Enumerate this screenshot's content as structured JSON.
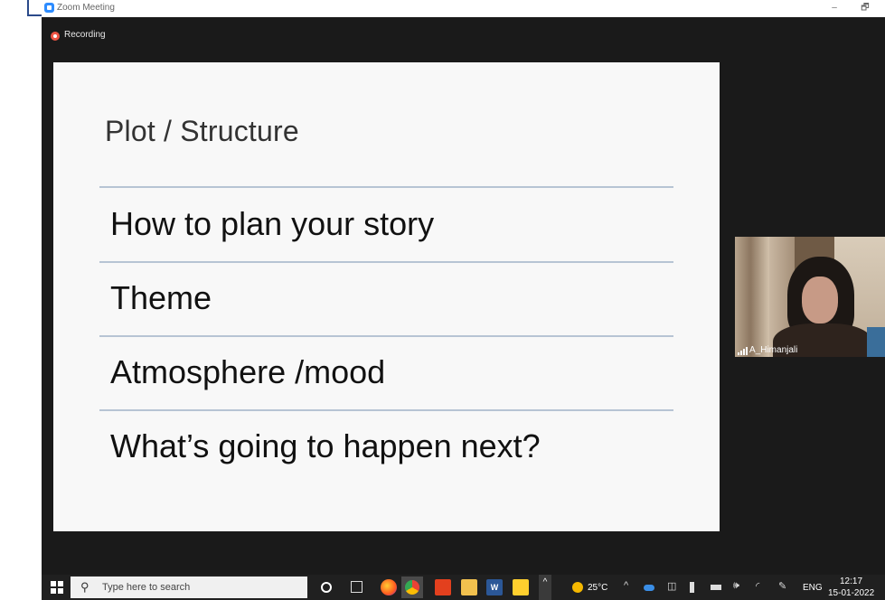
{
  "window": {
    "title": "Zoom Meeting",
    "minimize_glyph": "–",
    "restore_glyph": "🗗"
  },
  "meeting": {
    "recording_label": "Recording"
  },
  "slide": {
    "title": "Plot / Structure",
    "bullets": [
      "How to plan your story",
      "Theme",
      "Atmosphere /mood",
      "What’s going to happen next?"
    ]
  },
  "participant": {
    "name": "A_Himanjali"
  },
  "taskbar": {
    "search_placeholder": "Type here to search",
    "search_glyph": "⚲",
    "word_glyph": "W",
    "chevron_glyph": "^",
    "temperature": "25°C",
    "tray_up_glyph": "^",
    "meet_glyph": "◫",
    "volume_glyph": "🕪",
    "wifi_glyph": "◜",
    "pen_glyph": "✎",
    "language": "ENG",
    "time": "12:17",
    "date": "15-01-2022"
  }
}
